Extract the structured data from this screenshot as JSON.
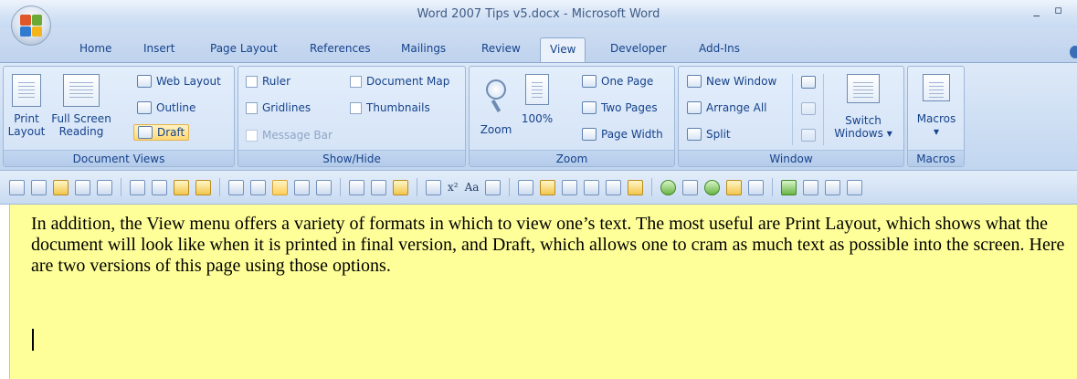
{
  "window": {
    "title": "Word 2007 Tips v5.docx - Microsoft Word",
    "controls": "_ ▫"
  },
  "tabs": [
    "Home",
    "Insert",
    "Page Layout",
    "References",
    "Mailings",
    "Review",
    "View",
    "Developer",
    "Add-Ins"
  ],
  "active_tab": "View",
  "ribbon": {
    "document_views": {
      "label": "Document Views",
      "print_layout": "Print Layout",
      "full_screen_reading": "Full Screen Reading",
      "web_layout": "Web Layout",
      "outline": "Outline",
      "draft": "Draft"
    },
    "show_hide": {
      "label": "Show/Hide",
      "ruler": "Ruler",
      "gridlines": "Gridlines",
      "message_bar": "Message Bar",
      "document_map": "Document Map",
      "thumbnails": "Thumbnails"
    },
    "zoom": {
      "label": "Zoom",
      "zoom": "Zoom",
      "hundred": "100%",
      "one_page": "One Page",
      "two_pages": "Two Pages",
      "page_width": "Page Width"
    },
    "window": {
      "label": "Window",
      "new_window": "New Window",
      "arrange_all": "Arrange All",
      "split": "Split",
      "switch_windows": "Switch Windows"
    },
    "macros": {
      "label": "Macros",
      "macros": "Macros"
    }
  },
  "toolbar": {
    "superscript": "x²",
    "font_case": "Aa"
  },
  "document": {
    "text": "In addition, the View menu offers a variety of formats in which to view one’s text. The most useful are Print Layout, which shows what the document will look like when it is printed in final version, and Draft, which allows one to cram as much text as possible into the screen. Here are two versions of this page using those options."
  },
  "colors": {
    "document_background": "#ffff99",
    "ribbon_text": "#15428b"
  }
}
